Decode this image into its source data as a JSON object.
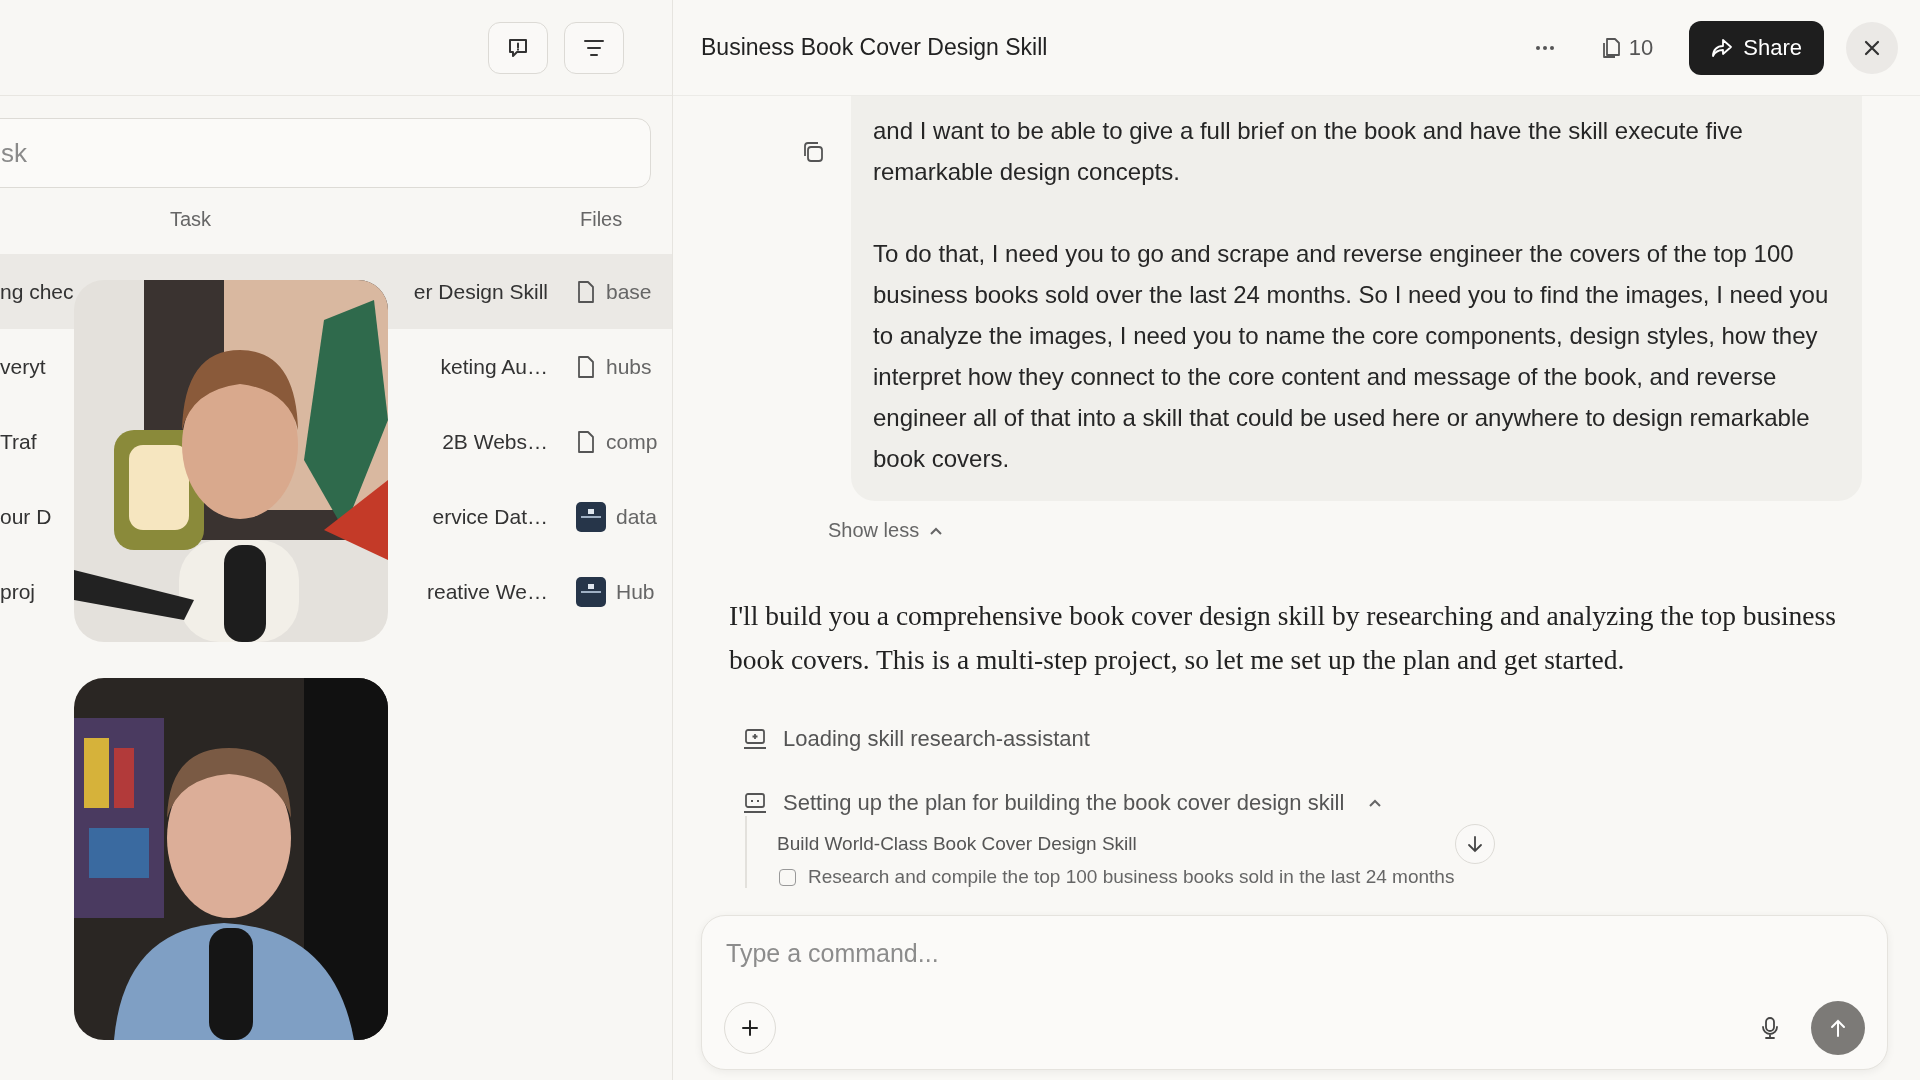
{
  "sidebar": {
    "search": {
      "placeholder": "sk"
    },
    "columns": [
      "Task",
      "Files"
    ],
    "rows": [
      {
        "column_1": "ng chec",
        "task": "er Design Skill",
        "file": {
          "name": "base",
          "kind": "document"
        },
        "selected": true
      },
      {
        "column_1": "veryt",
        "task": "keting Au…",
        "file": {
          "name": "hubs",
          "kind": "document"
        },
        "selected": false
      },
      {
        "column_1": "Traf",
        "task": "2B Webs…",
        "file": {
          "name": "comp",
          "kind": "document"
        },
        "selected": false
      },
      {
        "column_1": "our D",
        "task": "ervice Dat…",
        "file": {
          "name": "data",
          "kind": "thumbnail"
        },
        "selected": false
      },
      {
        "column_1": "proj",
        "task": "reative We…",
        "file": {
          "name": "Hub",
          "kind": "thumbnail"
        },
        "selected": false
      }
    ]
  },
  "header": {
    "title": "Business Book Cover Design Skill",
    "count": "10",
    "share": "Share"
  },
  "message": {
    "paragraphs": [
      "and I want to be able to give a full brief on the book and have the skill execute five remarkable design concepts.",
      "To do that, I need you to go and scrape and reverse engineer the covers of the top 100 business books sold over the last 24 months. So I need you to find the images, I need you to analyze the images, I need you to name the core components, design styles, how they interpret how they connect to the core content and message of the book, and reverse engineer all of that into a skill that could be used here or anywhere to design remarkable book covers."
    ],
    "toggle": "Show less"
  },
  "reply": "I'll build you a comprehensive book cover design skill by researching and analyzing the top business book covers. This is a multi-step project, so let me set up the plan and get started.",
  "steps": [
    {
      "kind": "skill",
      "text": "Loading skill research-assistant"
    },
    {
      "kind": "plan",
      "text": "Setting up the plan for building the book cover design skill",
      "expanded": true,
      "plan_title": "Build World-Class Book Cover Design Skill",
      "tasks": [
        {
          "text": "Research and compile the top 100 business books sold in the last 24 months",
          "checked": false
        }
      ]
    }
  ],
  "composer": {
    "placeholder": "Type a command..."
  }
}
